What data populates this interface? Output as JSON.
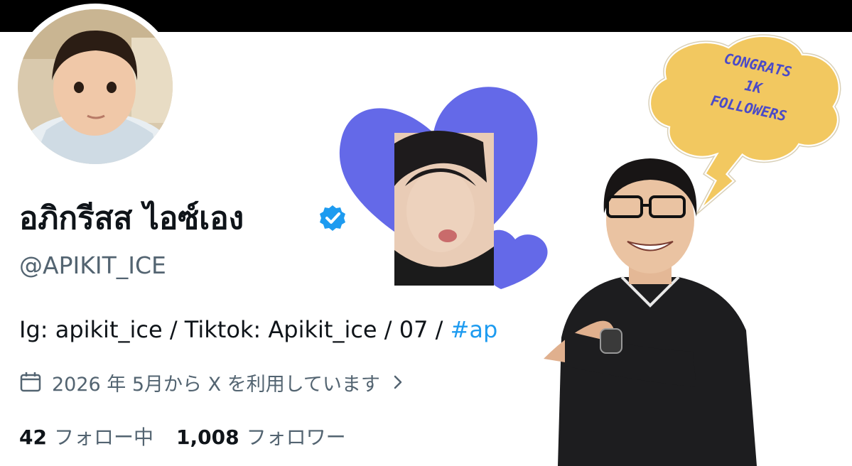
{
  "profile": {
    "display_name": "อภิกรีสส ไอซ์เอง",
    "handle": "@APIKIT_ICE",
    "bio_text": "Ig: apikit_ice / Tiktok: Apikit_ice / 07 / ",
    "bio_hashtag": "#ap",
    "joined": "2026 年 5月から X を利用しています",
    "following_count": "42",
    "following_label": "フォロー中",
    "followers_count": "1,008",
    "followers_label": "フォロワー"
  },
  "overlay": {
    "bubble_lines": [
      "CONGRATS",
      "1K",
      "FOLLOWERS"
    ]
  },
  "icons": {
    "verified": "verified-badge-icon",
    "calendar": "calendar-icon",
    "chevron": "chevron-right-icon"
  },
  "colors": {
    "text": "#0f1419",
    "secondary": "#536471",
    "link": "#1d9bf0",
    "verified": "#1d9bf0",
    "heart": "#6469e8",
    "bubble": "#f2c860"
  }
}
